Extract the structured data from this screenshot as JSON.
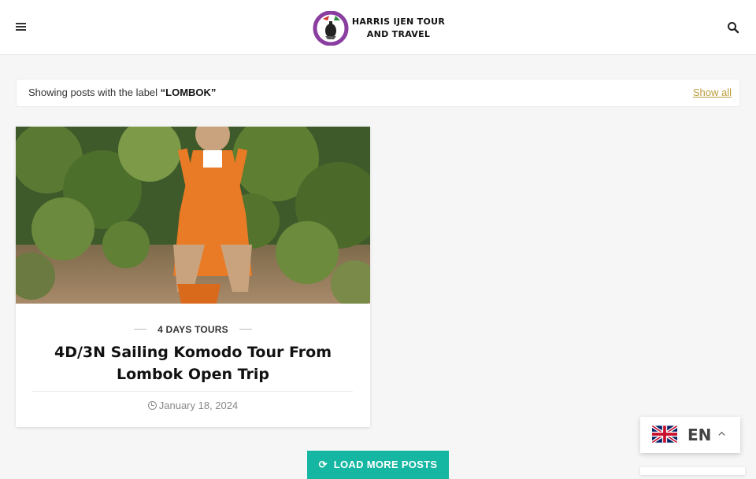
{
  "header": {
    "brand_line1": "HARRIS IJEN TOUR",
    "brand_line2": "AND TRAVEL",
    "menu_icon": "hamburger-icon",
    "search_icon": "search-icon"
  },
  "label_bar": {
    "prefix": "Showing posts with the label ",
    "label": "“LOMBOK”",
    "show_all": "Show all"
  },
  "post": {
    "category": "4 DAYS TOURS",
    "title": "4D/3N Sailing Komodo Tour From Lombok Open Trip",
    "date": "January 18, 2024"
  },
  "load_more": {
    "label": "LOAD MORE POSTS",
    "icon": "refresh-icon"
  },
  "language": {
    "code": "EN",
    "flag": "uk-flag-icon"
  },
  "colors": {
    "accent": "#16b7a2",
    "link": "#bd9c3b",
    "background": "#f6f6f6"
  }
}
